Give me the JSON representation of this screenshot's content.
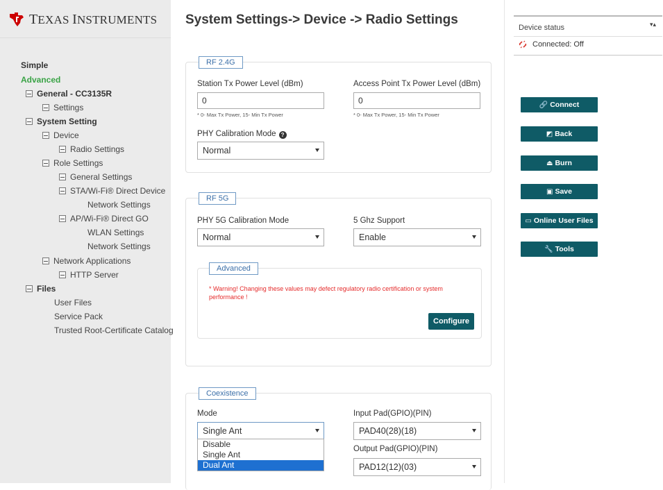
{
  "brand": {
    "name_first_cap": "T",
    "name_first_rest": "EXAS",
    "name_second_cap": "I",
    "name_second_rest": "NSTRUMENTS",
    "logo_color": "#cc0000"
  },
  "page": {
    "title": "System Settings-> Device -> Radio Settings"
  },
  "sidebar": {
    "items": [
      {
        "label": "Simple",
        "level": 0,
        "style": "bold"
      },
      {
        "label": "Advanced",
        "level": 0,
        "style": "green"
      },
      {
        "label": "General - CC3135R",
        "toggle": true,
        "style": "bold"
      },
      {
        "label": "Settings",
        "toggle": true
      },
      {
        "label": "System Setting",
        "toggle": true,
        "style": "bold"
      },
      {
        "label": "Device",
        "toggle": true
      },
      {
        "label": "Radio Settings",
        "toggle": true
      },
      {
        "label": "Role Settings",
        "toggle": true
      },
      {
        "label": "General Settings",
        "toggle": true
      },
      {
        "label": "STA/Wi-Fi® Direct Device",
        "toggle": true
      },
      {
        "label": "Network Settings"
      },
      {
        "label": "AP/Wi-Fi® Direct GO",
        "toggle": true
      },
      {
        "label": "WLAN Settings"
      },
      {
        "label": "Network Settings"
      },
      {
        "label": "Network Applications",
        "toggle": true
      },
      {
        "label": "HTTP Server",
        "toggle": true
      },
      {
        "label": "Files",
        "toggle": true,
        "style": "bold"
      },
      {
        "label": "User Files"
      },
      {
        "label": "Service Pack"
      },
      {
        "label": "Trusted Root-Certificate Catalog"
      }
    ]
  },
  "rf24": {
    "legend": "RF 2.4G",
    "station_label": "Station Tx Power Level (dBm)",
    "station_value": "0",
    "station_hint": "* 0- Max Tx Power, 15- Min Tx Power",
    "ap_label": "Access Point Tx Power Level (dBm)",
    "ap_value": "0",
    "ap_hint": "* 0- Max Tx Power, 15- Min Tx Power",
    "phy_label": "PHY Calibration Mode",
    "phy_value": "Normal"
  },
  "rf5": {
    "legend": "RF 5G",
    "phy_label": "PHY 5G Calibration Mode",
    "phy_value": "Normal",
    "support_label": "5 Ghz Support",
    "support_value": "Enable",
    "advanced_legend": "Advanced",
    "warning": "* Warning! Changing these values may defect regulatory radio certification or system performance !",
    "configure_label": "Configure"
  },
  "coexistence": {
    "legend": "Coexistence",
    "mode_label": "Mode",
    "mode_value": "Single Ant",
    "mode_options": [
      "Disable",
      "Single Ant",
      "Dual Ant"
    ],
    "mode_highlighted": "Dual Ant",
    "input_pad_label": "Input Pad(GPIO)(PIN)",
    "input_pad_value": "PAD40(28)(18)",
    "output_pad_label": "Output Pad(GPIO)(PIN)",
    "output_pad_value": "PAD12(12)(03)"
  },
  "status": {
    "title": "Device status",
    "arrow": "▾▴",
    "connection": "Connected: Off"
  },
  "actions": [
    {
      "label": "Connect",
      "icon": "link-icon",
      "glyph": "🔗"
    },
    {
      "label": "Back",
      "icon": "back-icon",
      "glyph": "◩"
    },
    {
      "label": "Burn",
      "icon": "burn-icon",
      "glyph": "⏏"
    },
    {
      "label": "Save",
      "icon": "save-icon",
      "glyph": "▣"
    },
    {
      "label": "Online User Files",
      "icon": "folder-icon",
      "glyph": "▭"
    },
    {
      "label": "Tools",
      "icon": "wrench-icon",
      "glyph": "🔧"
    }
  ],
  "colors": {
    "accent": "#0f5b66",
    "link": "#3b6fa8",
    "warning": "#e52b2b",
    "active_tree": "#3aa346",
    "dropdown_highlight": "#1e70d1"
  }
}
